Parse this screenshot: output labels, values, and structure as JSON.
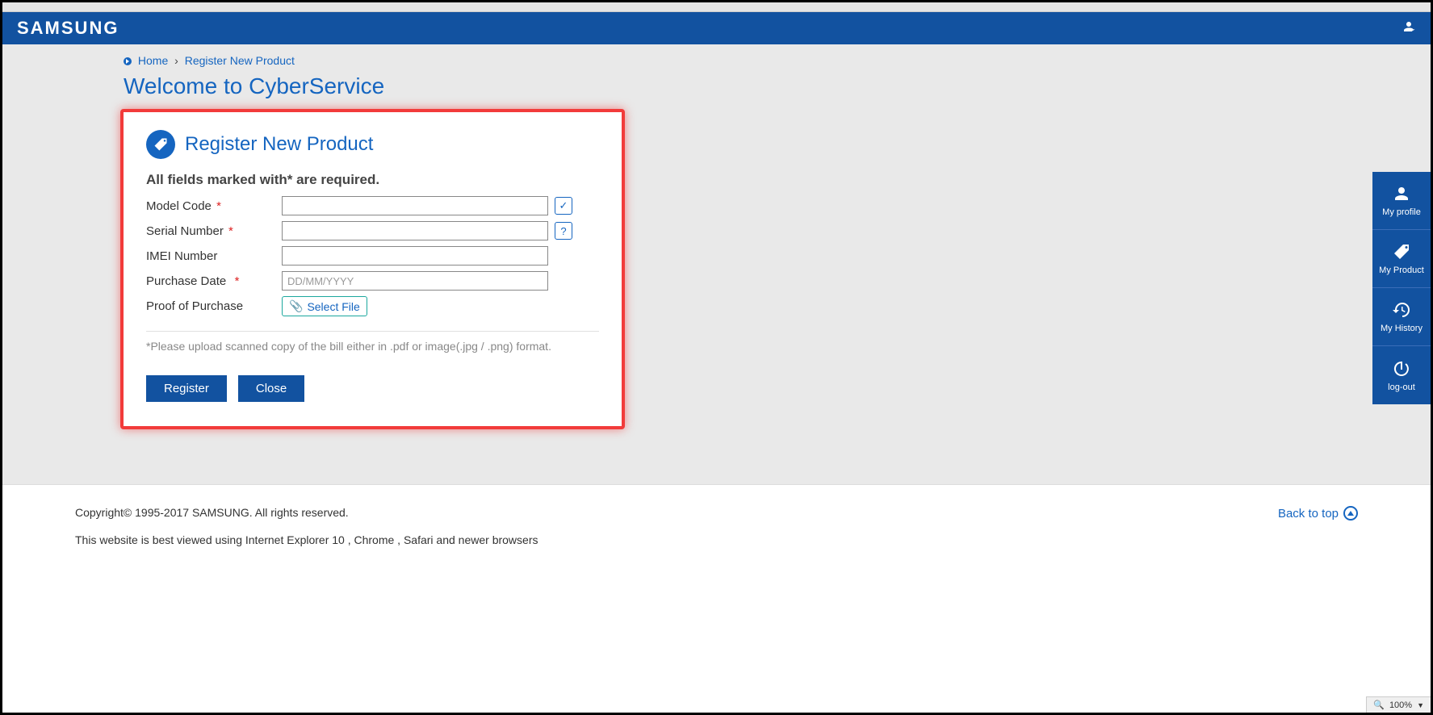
{
  "header": {
    "logo": "SAMSUNG"
  },
  "breadcrumb": {
    "home": "Home",
    "current": "Register New Product"
  },
  "page_title": "Welcome to CyberService",
  "panel": {
    "title": "Register New Product",
    "required_note": "All fields marked with* are required.",
    "fields": {
      "model_code": {
        "label": "Model Code",
        "required": true,
        "value": ""
      },
      "serial_number": {
        "label": "Serial Number",
        "required": true,
        "value": ""
      },
      "imei_number": {
        "label": "IMEI Number",
        "required": false,
        "value": ""
      },
      "purchase_date": {
        "label": "Purchase Date",
        "required": true,
        "value": "",
        "placeholder": "DD/MM/YYYY"
      },
      "proof_of_purchase": {
        "label": "Proof of Purchase",
        "button": "Select File"
      }
    },
    "upload_note": "*Please upload scanned copy of the bill either in .pdf or image(.jpg / .png) format.",
    "buttons": {
      "register": "Register",
      "close": "Close"
    }
  },
  "side_rail": {
    "items": [
      {
        "label": "My profile",
        "icon": "person-icon"
      },
      {
        "label": "My Product",
        "icon": "tag-icon"
      },
      {
        "label": "My History",
        "icon": "history-icon"
      },
      {
        "label": "log-out",
        "icon": "power-icon"
      }
    ]
  },
  "footer": {
    "copyright": "Copyright© 1995-2017 SAMSUNG. All rights reserved.",
    "browser_note": "This website is best viewed using Internet Explorer 10 , Chrome , Safari and newer browsers",
    "back_to_top": "Back to top"
  },
  "status": {
    "zoom": "100%"
  }
}
